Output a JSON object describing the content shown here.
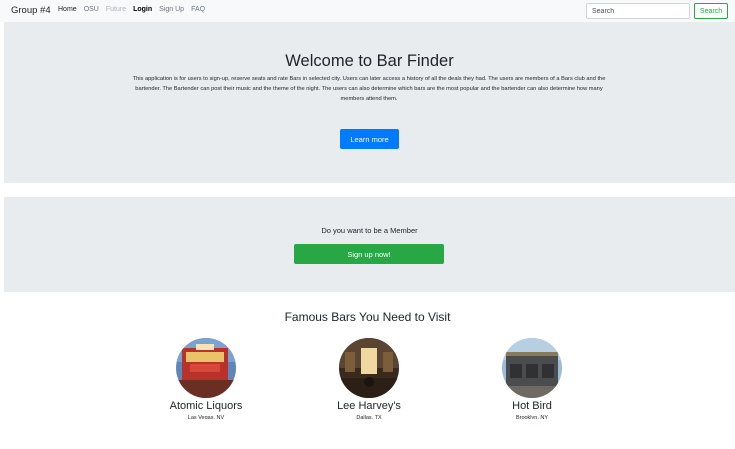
{
  "navbar": {
    "brand": "Group #4",
    "links": [
      {
        "label": "Home"
      },
      {
        "label": "OSU"
      },
      {
        "label": "Future"
      },
      {
        "label": "Login"
      },
      {
        "label": "Sign Up"
      },
      {
        "label": "FAQ"
      }
    ],
    "search_placeholder": "Search",
    "search_button": "Search"
  },
  "hero": {
    "title": "Welcome to Bar Finder",
    "description": "This application is for users to sign-up, reserve seats and rate Bars in selected city. Users can later access a history of all the deals they had. The users are members of a Bars club and the bartender. The Bartender can post their music and the theme of the night. The users can also determine which bars are the most popular and the bartender can also determine how many members attend them.",
    "button": "Learn more"
  },
  "member": {
    "question": "Do you want to be a Member",
    "button": "Sign up now!"
  },
  "bars": {
    "heading": "Famous Bars You Need to Visit",
    "items": [
      {
        "name": "Atomic Liquors",
        "location": "Las Vegas, NV"
      },
      {
        "name": "Lee Harvey's",
        "location": "Dallas, TX"
      },
      {
        "name": "Hot Bird",
        "location": "Brooklyn, NY"
      }
    ]
  },
  "colors": {
    "primary": "#007bff",
    "success": "#28a745",
    "jumbotron": "#e9ecef",
    "navbar": "#f8f9fa"
  }
}
